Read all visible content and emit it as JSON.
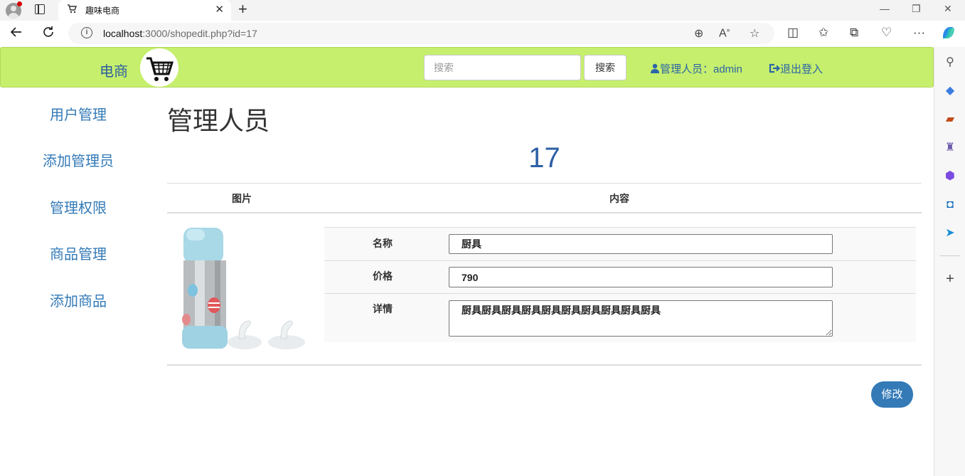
{
  "browser": {
    "tab_title": "趣味电商",
    "tab_favicon": "cart-icon",
    "url_host": "localhost",
    "url_rest": ":3000/shopedit.php?id=17"
  },
  "header": {
    "brand": "电商",
    "search_placeholder": "搜索",
    "search_button": "搜索",
    "admin_label": "管理人员：admin",
    "logout_label": "退出登入",
    "background": "#c5ef6d"
  },
  "sidebar": {
    "items": [
      {
        "label": "用户管理"
      },
      {
        "label": "添加管理员"
      },
      {
        "label": "管理权限"
      },
      {
        "label": "商品管理"
      },
      {
        "label": "添加商品"
      }
    ]
  },
  "main": {
    "title": "管理人员",
    "record_id": "17",
    "columns": [
      "图片",
      "内容"
    ],
    "fields": {
      "name_label": "名称",
      "name_value": "厨具",
      "price_label": "价格",
      "price_value": "790",
      "detail_label": "详情",
      "detail_value": "厨具厨具厨具厨具厨具厨具厨具厨具厨具厨具"
    },
    "submit_label": "修改",
    "accent": "#337ab7"
  }
}
